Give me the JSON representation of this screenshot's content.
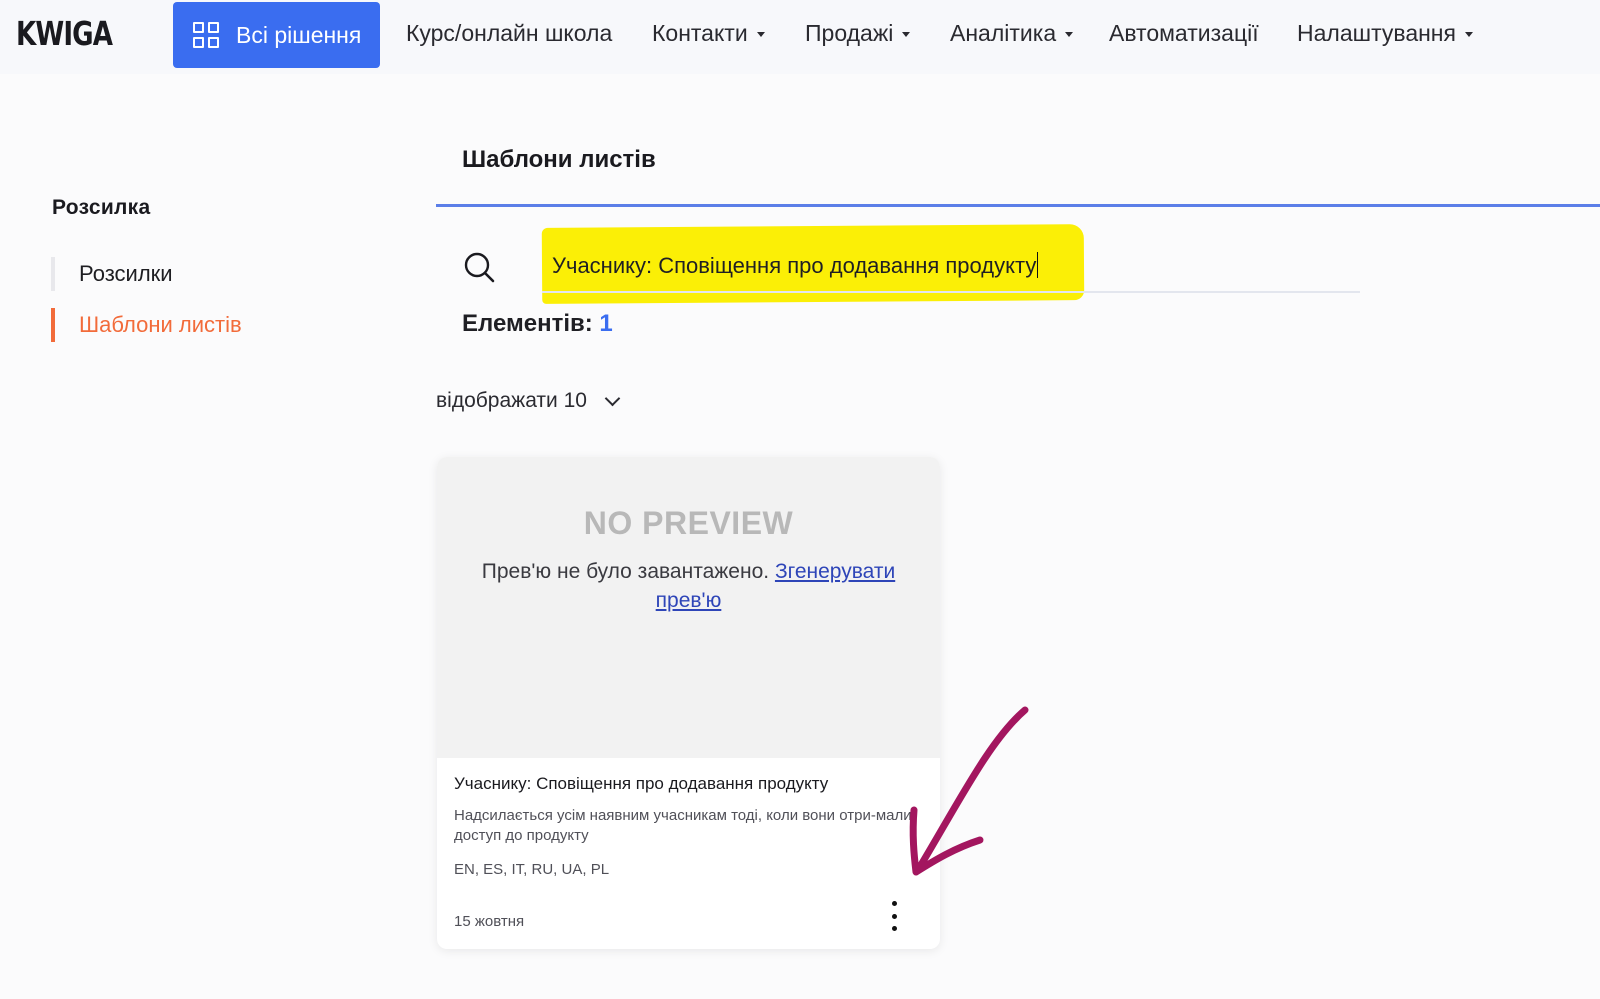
{
  "nav": {
    "logo": "KWIGA",
    "all_solutions": "Всі рішення",
    "items": [
      {
        "label": "Курс/онлайн школа"
      },
      {
        "label": "Контакти"
      },
      {
        "label": "Продажі"
      },
      {
        "label": "Аналітика"
      },
      {
        "label": "Автоматизації"
      },
      {
        "label": "Налаштування"
      }
    ]
  },
  "sidebar": {
    "title": "Розсилка",
    "items": [
      {
        "label": "Розсилки"
      },
      {
        "label": "Шаблони листів"
      }
    ]
  },
  "main": {
    "title": "Шаблони листів",
    "search_value": "Учаснику: Сповіщення про додавання продукту",
    "count_label": "Елементів:",
    "count_value": "1",
    "show_label": "відображати 10"
  },
  "card": {
    "no_preview": "NO PREVIEW",
    "preview_msg": "Прев'ю не було завантажено.",
    "generate_link": "Згенерувати прев'ю",
    "title": "Учаснику: Сповіщення про додавання продукту",
    "description": "Надсилається усім наявним учасникам тоді, коли вони отри-мали доступ до продукту",
    "languages": "EN, ES, IT, RU, UA, PL",
    "date": "15 жовтня"
  },
  "colors": {
    "primary": "#3a6df0",
    "accent_active": "#f26b3a",
    "highlight": "#fbef06",
    "annotation_arrow": "#a3165f"
  }
}
